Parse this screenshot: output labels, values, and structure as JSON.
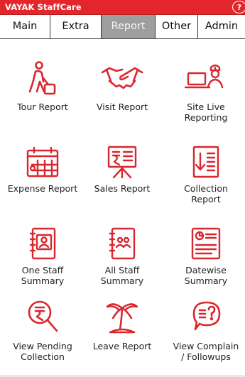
{
  "app": {
    "title": "VAYAK StaffCare",
    "help_glyph": "?"
  },
  "tabs": [
    {
      "label": "Main",
      "active": false
    },
    {
      "label": "Extra",
      "active": false
    },
    {
      "label": "Report",
      "active": true
    },
    {
      "label": "Other",
      "active": false
    },
    {
      "label": "Admin",
      "active": false
    }
  ],
  "tiles": [
    {
      "icon": "tour-traveler-icon",
      "label1": "Tour Report",
      "label2": ""
    },
    {
      "icon": "handshake-icon",
      "label1": "Visit Report",
      "label2": ""
    },
    {
      "icon": "site-live-reporting-icon",
      "label1": "Site Live",
      "label2": "Reporting"
    },
    {
      "icon": "calendar-expense-icon",
      "label1": "Expense Report",
      "label2": ""
    },
    {
      "icon": "sales-easel-icon",
      "label1": "Sales Report",
      "label2": ""
    },
    {
      "icon": "collection-report-icon",
      "label1": "Collection",
      "label2": "Report"
    },
    {
      "icon": "one-staff-book-icon",
      "label1": "One Staff",
      "label2": "Summary"
    },
    {
      "icon": "all-staff-book-icon",
      "label1": "All Staff",
      "label2": "Summary"
    },
    {
      "icon": "datewise-report-icon",
      "label1": "Datewise",
      "label2": "Summary"
    },
    {
      "icon": "rupee-search-icon",
      "label1": "View Pending",
      "label2": "Collection"
    },
    {
      "icon": "palm-tree-icon",
      "label1": "Leave Report",
      "label2": ""
    },
    {
      "icon": "complaint-chat-icon",
      "label1": "View Complain",
      "label2": "/ Followups"
    }
  ],
  "colors": {
    "brand_red": "#e3252c",
    "active_tab": "#9e9e9e",
    "icon_red": "#d9272e"
  }
}
